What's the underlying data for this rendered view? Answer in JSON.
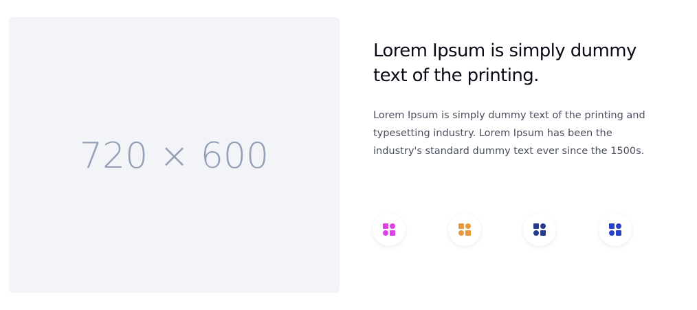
{
  "image_placeholder": {
    "label": "720 × 600"
  },
  "feature": {
    "heading": "Lorem Ipsum is simply dummy text of the printing.",
    "description": "Lorem Ipsum is simply dummy text of the printing and typesetting industry. Lorem Ipsum has been the industry's standard dummy text ever since the 1500s."
  },
  "icons": [
    {
      "name": "apps-icon",
      "color": "#e040e8"
    },
    {
      "name": "apps-icon",
      "color": "#e89a3c"
    },
    {
      "name": "apps-icon",
      "color": "#243b8e"
    },
    {
      "name": "apps-icon",
      "color": "#2a42c8"
    }
  ]
}
